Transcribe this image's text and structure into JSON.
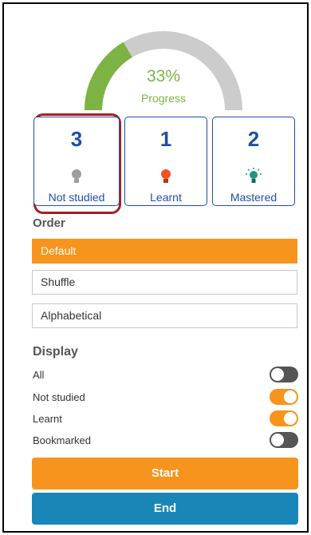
{
  "progress": {
    "percent_text": "33%",
    "label": "Progress",
    "value": 0.33
  },
  "cards": [
    {
      "count": "3",
      "label": "Not studied",
      "bulb_color": "#9e9e9e"
    },
    {
      "count": "1",
      "label": "Learnt",
      "bulb_color": "#f4511e"
    },
    {
      "count": "2",
      "label": "Mastered",
      "bulb_color": "#1a9a7a"
    }
  ],
  "order": {
    "title": "Order",
    "options": [
      "Default",
      "Shuffle",
      "Alphabetical"
    ],
    "selected": "Default"
  },
  "display": {
    "title": "Display",
    "toggles": [
      {
        "label": "All",
        "on": false
      },
      {
        "label": "Not studied",
        "on": true
      },
      {
        "label": "Learnt",
        "on": true
      },
      {
        "label": "Bookmarked",
        "on": false
      }
    ]
  },
  "buttons": {
    "start": "Start",
    "end": "End"
  },
  "colors": {
    "accent": "#f7941d",
    "primary": "#1e4fa8",
    "end_button": "#1a86b8",
    "progress_green": "#7cb342",
    "gauge_track": "#cccccc",
    "highlight": "#a71e22"
  }
}
